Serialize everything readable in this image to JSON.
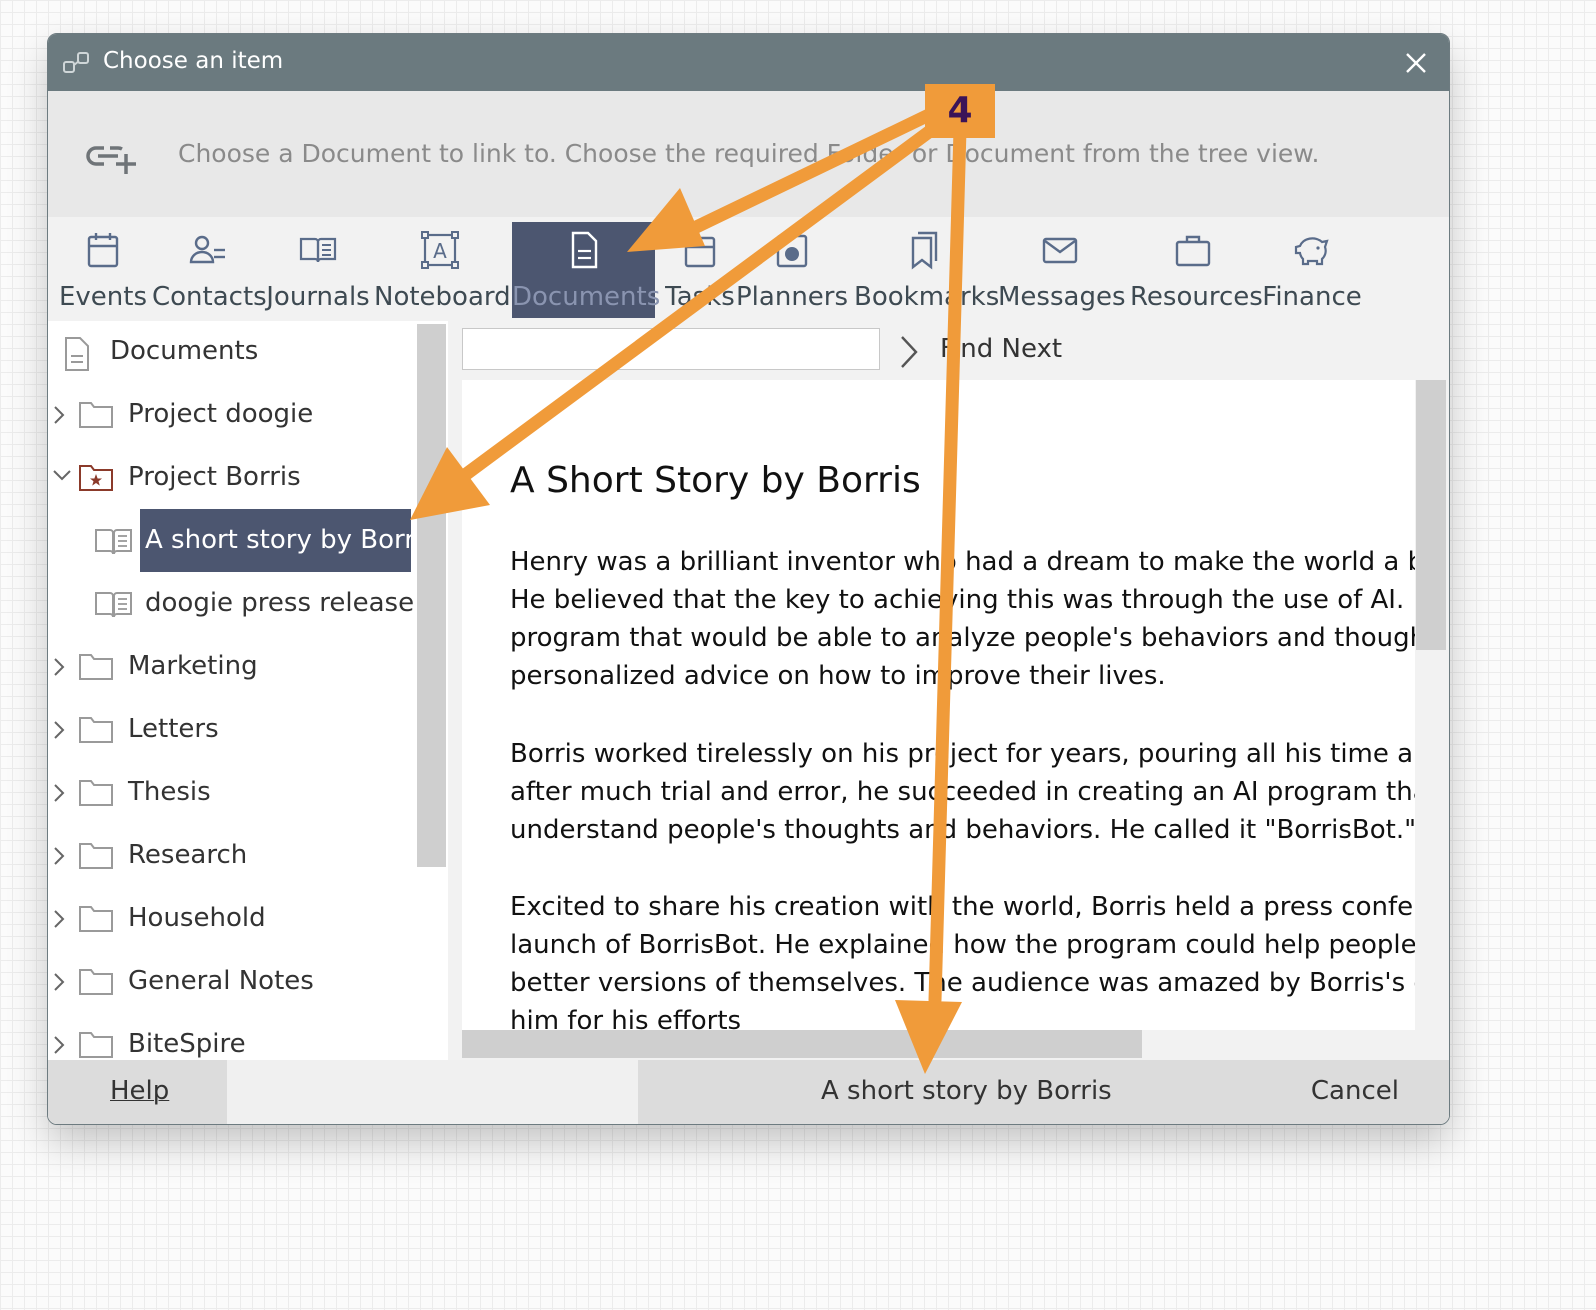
{
  "dialog": {
    "title": "Choose an item",
    "instruction": "Choose a Document to link to. Choose the required Folder or Document from the tree view."
  },
  "tabs": [
    {
      "label": "Events",
      "icon": "calendar-icon"
    },
    {
      "label": "Contacts",
      "icon": "contacts-icon"
    },
    {
      "label": "Journals",
      "icon": "journal-book-icon"
    },
    {
      "label": "Noteboard",
      "icon": "noteboard-icon"
    },
    {
      "label": "Documents",
      "icon": "document-icon",
      "active": true
    },
    {
      "label": "Tasks",
      "icon": "tasks-icon"
    },
    {
      "label": "Planners",
      "icon": "planner-icon"
    },
    {
      "label": "Bookmarks",
      "icon": "bookmark-icon"
    },
    {
      "label": "Messages",
      "icon": "envelope-icon"
    },
    {
      "label": "Resources",
      "icon": "briefcase-icon"
    },
    {
      "label": "Finance",
      "icon": "piggy-bank-icon"
    }
  ],
  "tree": {
    "root": "Documents",
    "items": [
      {
        "label": "Project doogie",
        "type": "folder",
        "expanded": false
      },
      {
        "label": "Project Borris",
        "type": "folder-starred",
        "expanded": true
      },
      {
        "label": "A short story by Borris",
        "type": "document",
        "selected": true
      },
      {
        "label": "doogie press release",
        "type": "document"
      },
      {
        "label": "Marketing",
        "type": "folder"
      },
      {
        "label": "Letters",
        "type": "folder"
      },
      {
        "label": "Thesis",
        "type": "folder"
      },
      {
        "label": "Research",
        "type": "folder"
      },
      {
        "label": "Household",
        "type": "folder"
      },
      {
        "label": "General Notes",
        "type": "folder"
      },
      {
        "label": "BiteSpire",
        "type": "folder"
      }
    ]
  },
  "search": {
    "value": "",
    "find_next_label": "Find Next"
  },
  "document": {
    "title": "A Short Story by Borris",
    "paragraphs": [
      [
        "Henry was a brilliant inventor who had a dream to make the world a be",
        "He believed that the key to achieving this was through the use of AI. He",
        "program that would be able to analyze people's behaviors and thought",
        "personalized advice on how to improve their lives."
      ],
      [
        "Borris worked tirelessly on his project for years, pouring all his time and",
        "after much trial and error, he succeeded in creating an AI program that",
        "understand people's thoughts and behaviors. He called it \"BorrisBot.\""
      ],
      [
        "Excited to share his creation with the world, Borris held a press confere",
        "launch of BorrisBot. He explained how the program could help people b",
        "better versions of themselves. The audience was amazed by Borris's cr",
        "him for his efforts"
      ]
    ]
  },
  "footer": {
    "help_label": "Help",
    "status": "A short story by Borris",
    "cancel_label": "Cancel"
  },
  "annotation": {
    "badge": "4",
    "color": "#f09b3a"
  },
  "colors": {
    "titlebar": "#6b7a7f",
    "selected": "#4c5670",
    "accent": "#f09b3a"
  }
}
